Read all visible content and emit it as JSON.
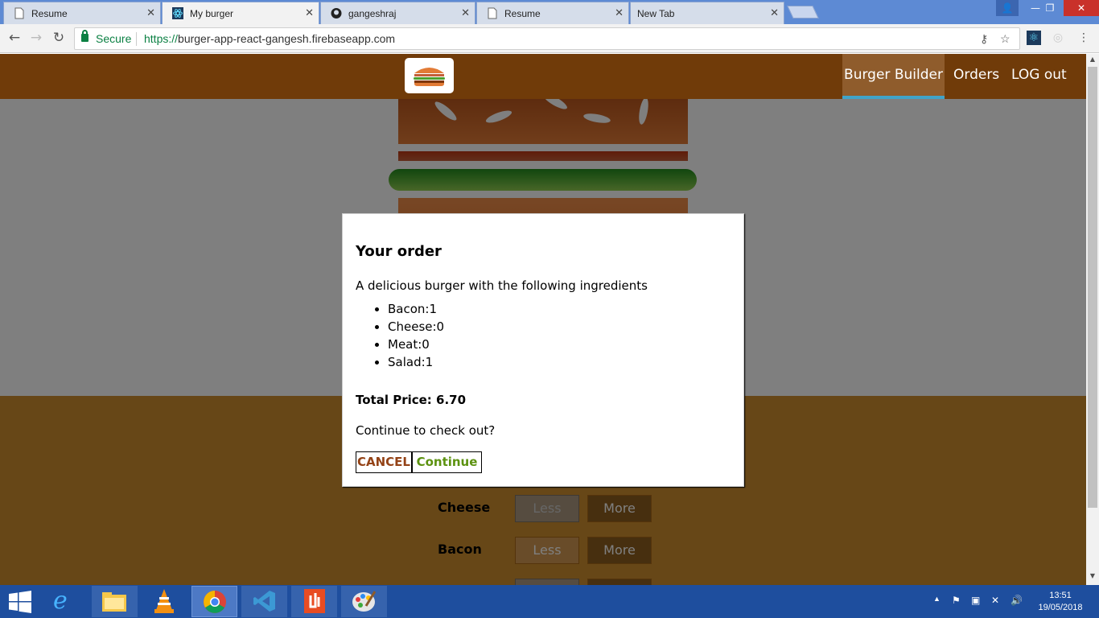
{
  "browser": {
    "tabs": [
      {
        "title": "Resume",
        "icon": "document-icon",
        "active": false
      },
      {
        "title": "My burger",
        "icon": "react-icon",
        "active": true
      },
      {
        "title": "gangeshraj",
        "icon": "github-icon",
        "active": false
      },
      {
        "title": "Resume",
        "icon": "document-icon",
        "active": false
      },
      {
        "title": "New Tab",
        "icon": "",
        "active": false
      }
    ],
    "security_label": "Secure",
    "url_scheme": "https://",
    "url_host": "burger-app-react-gangesh.firebaseapp.com"
  },
  "app": {
    "nav": [
      {
        "label": "Burger Builder",
        "active": true
      },
      {
        "label": "Orders",
        "active": false
      },
      {
        "label": "LOG out",
        "active": false
      }
    ],
    "controls": [
      {
        "label": "Cheese",
        "less": "Less",
        "more": "More",
        "less_disabled": true
      },
      {
        "label": "Bacon",
        "less": "Less",
        "more": "More",
        "less_disabled": false
      }
    ]
  },
  "modal": {
    "title": "Your order",
    "description": "A delicious burger with the following ingredients",
    "ingredients": [
      "Bacon:1",
      "Cheese:0",
      "Meat:0",
      "Salad:1"
    ],
    "total_label": "Total Price: 6.70",
    "question": "Continue to check out?",
    "cancel_label": "CANCEL",
    "continue_label": "Continue"
  },
  "taskbar": {
    "time": "13:51",
    "date": "19/05/2018",
    "apps": [
      "windows-start-icon",
      "internet-explorer-icon",
      "file-explorer-icon",
      "vlc-icon",
      "chrome-icon",
      "vscode-icon",
      "office-icon",
      "paint-icon"
    ]
  },
  "colors": {
    "navbar": "#703b09",
    "controls_bg": "#cf8f2e",
    "cancel": "#944317",
    "continue": "#5c9210"
  }
}
